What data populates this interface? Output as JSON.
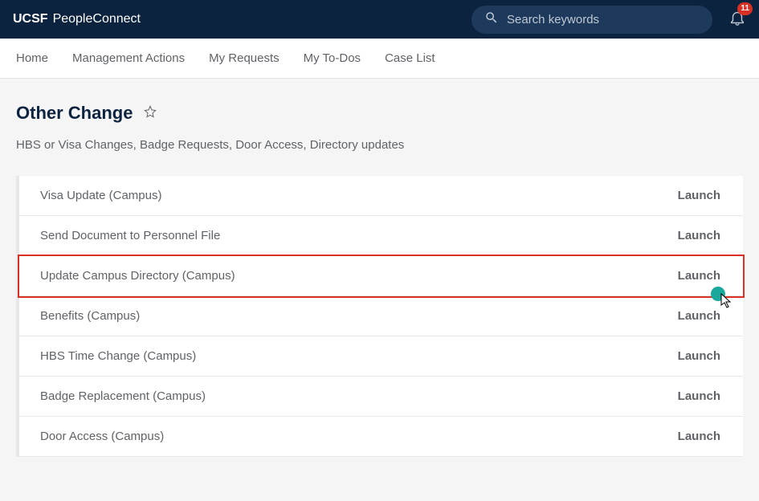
{
  "brand": {
    "bold": "UCSF",
    "light": "PeopleConnect"
  },
  "search": {
    "placeholder": "Search keywords"
  },
  "notifications": {
    "count": "11"
  },
  "nav": [
    {
      "label": "Home"
    },
    {
      "label": "Management Actions"
    },
    {
      "label": "My Requests"
    },
    {
      "label": "My To-Dos"
    },
    {
      "label": "Case List"
    }
  ],
  "page": {
    "title": "Other Change",
    "subtitle": "HBS or Visa Changes, Badge Requests, Door Access, Directory updates"
  },
  "rows": [
    {
      "title": "Visa Update (Campus)",
      "action": "Launch"
    },
    {
      "title": "Send Document to Personnel File",
      "action": "Launch"
    },
    {
      "title": "Update Campus Directory (Campus)",
      "action": "Launch"
    },
    {
      "title": "Benefits (Campus)",
      "action": "Launch"
    },
    {
      "title": "HBS Time Change (Campus)",
      "action": "Launch"
    },
    {
      "title": "Badge Replacement (Campus)",
      "action": "Launch"
    },
    {
      "title": "Door Access (Campus)",
      "action": "Launch"
    }
  ]
}
